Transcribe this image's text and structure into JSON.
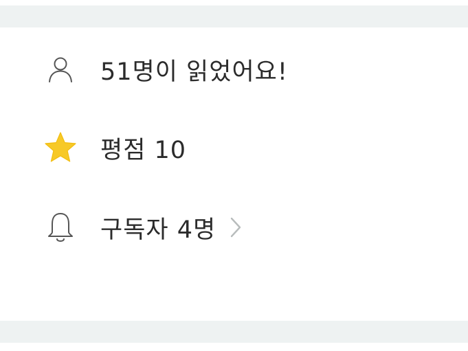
{
  "stats": {
    "readers": {
      "icon": "person-icon",
      "label": "51명이 읽었어요!"
    },
    "rating": {
      "icon": "star-icon",
      "label": "평점 10",
      "star_color": "#f7c928"
    },
    "subscribers": {
      "icon": "bell-icon",
      "label": "구독자 4명",
      "chevron": "chevron-right-icon"
    }
  },
  "colors": {
    "band": "#eef2f2",
    "text": "#2b2b2b",
    "icon_stroke": "#555555",
    "chevron": "#b8bcbc"
  }
}
